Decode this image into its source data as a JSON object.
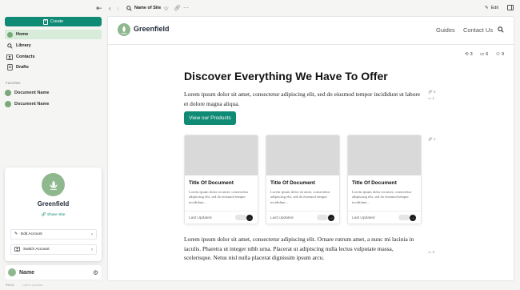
{
  "sidebar": {
    "create_label": "Create",
    "nav": [
      {
        "label": "Home",
        "icon": "home-icon"
      },
      {
        "label": "Library",
        "icon": "search-icon"
      },
      {
        "label": "Contacts",
        "icon": "contacts-icon"
      },
      {
        "label": "Drafts",
        "icon": "document-icon"
      }
    ],
    "favorites_heading": "Favorites",
    "favorites": [
      {
        "label": "Document Name"
      },
      {
        "label": "Document Name"
      }
    ],
    "profile": {
      "name": "Greenfield",
      "share_label": "Share Site",
      "edit_account_label": "Edit Account",
      "switch_account_label": "Switch Account"
    },
    "user": {
      "name": "Name"
    },
    "version": "®5.20",
    "version_extra": "Latest updates"
  },
  "toolbar": {
    "site_title": "Name of Site",
    "edit_label": "Edit"
  },
  "site": {
    "name": "Greenfield",
    "nav": [
      "Guides",
      "Contact Us"
    ],
    "stats": {
      "history": "3",
      "comments": "6",
      "readers": "9"
    },
    "heading": "Discover Everything We Have To Offer",
    "intro": "Lorem ipsum dolor sit amet, consectetur adipiscing elit, sed do eiusmod tempor incididunt ut labore et dolore magna aliqua.",
    "cta_label": "View our Products",
    "side_meta": {
      "links": "2",
      "comments": "1",
      "cards_links": "1",
      "bottom_comments": "2"
    },
    "cards": [
      {
        "title": "Title Of Document",
        "text": "Lorem ipsum dolor sit amet, consectetur adipiscing elit, sed do eiusmod tempor incididunt...",
        "updated": "Last Updated"
      },
      {
        "title": "Title Of Document",
        "text": "Lorem ipsum dolor sit amet, consectetur adipiscing elit, sed do eiusmod tempor incididunt...",
        "updated": "Last Updated"
      },
      {
        "title": "Title Of Document",
        "text": "Lorem ipsum dolor sit amet, consectetur adipiscing elit, sed do eiusmod tempor incididunt...",
        "updated": "Last Updated"
      }
    ],
    "body": "Lorem ipsum dolor sit amet, consectetur adipiscing elit. Ornare rutrum amet, a nunc mi lacinia in iaculis. Pharetra ut integer nibh urna. Placerat ut adipiscing nulla lectus vulputate massa, scelerisque. Netus nisl nulla placerat dignissim ipsum arcu."
  },
  "colors": {
    "accent": "#0f8a74",
    "brand_green": "#8fb88f",
    "active_nav": "#d7ecd9"
  }
}
